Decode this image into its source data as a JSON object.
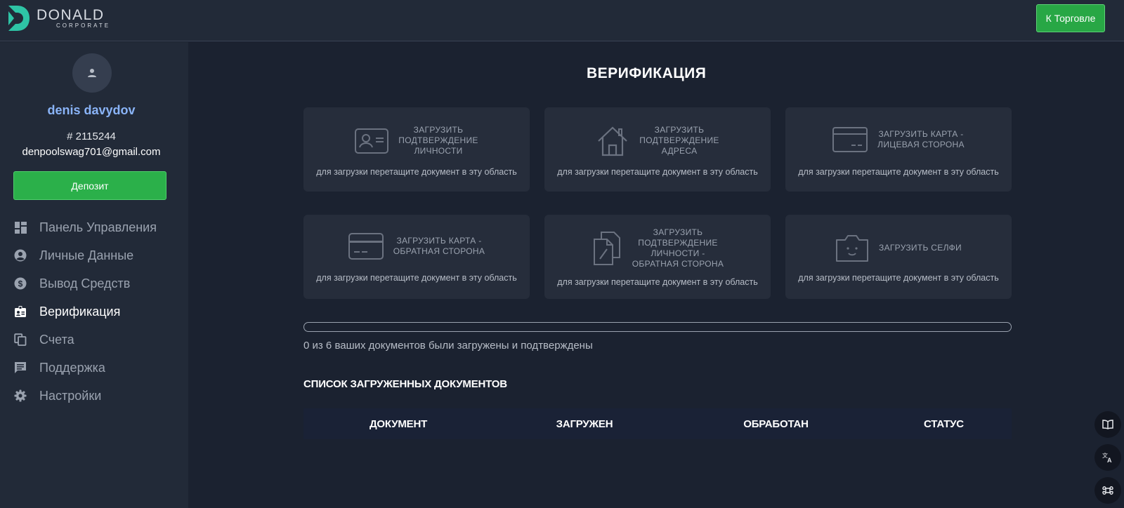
{
  "header": {
    "logo_name": "DONALD",
    "logo_sub": "CORPORATE",
    "trade_button": "К Торговле"
  },
  "sidebar": {
    "user_name": "denis davydov",
    "user_id": "# 2115244",
    "user_email": "denpoolswag701@gmail.com",
    "deposit_button": "Депозит",
    "items": [
      {
        "label": "Панель Управления",
        "icon": "dashboard-icon",
        "active": false
      },
      {
        "label": "Личные Данные",
        "icon": "account-circle-icon",
        "active": false
      },
      {
        "label": "Вывод Средств",
        "icon": "dollar-circle-icon",
        "active": false
      },
      {
        "label": "Верификация",
        "icon": "id-badge-icon",
        "active": true
      },
      {
        "label": "Счета",
        "icon": "copy-icon",
        "active": false
      },
      {
        "label": "Поддержка",
        "icon": "chat-icon",
        "active": false
      },
      {
        "label": "Настройки",
        "icon": "gear-icon",
        "active": false
      }
    ]
  },
  "main": {
    "title": "ВЕРИФИКАЦИЯ",
    "upload_hint": "для загрузки перетащите документ в эту область",
    "cards": [
      {
        "label_lines": [
          "ЗАГРУЗИТЬ",
          "ПОДТВЕРЖДЕНИЕ",
          "ЛИЧНОСТИ"
        ],
        "icon": "id-card-icon"
      },
      {
        "label_lines": [
          "ЗАГРУЗИТЬ",
          "ПОДТВЕРЖДЕНИЕ",
          "АДРЕСА"
        ],
        "icon": "house-icon"
      },
      {
        "label_lines": [
          "ЗАГРУЗИТЬ КАРТА -",
          "ЛИЦЕВАЯ СТОРОНА"
        ],
        "icon": "card-front-icon"
      },
      {
        "label_lines": [
          "ЗАГРУЗИТЬ КАРТА -",
          "ОБРАТНАЯ СТОРОНА"
        ],
        "icon": "card-back-icon"
      },
      {
        "label_lines": [
          "ЗАГРУЗИТЬ",
          "ПОДТВЕРЖДЕНИЕ",
          "ЛИЧНОСТИ -",
          "ОБРАТНАЯ СТОРОНА"
        ],
        "icon": "documents-icon"
      },
      {
        "label_lines": [
          "ЗАГРУЗИТЬ СЕЛФИ"
        ],
        "icon": "selfie-camera-icon"
      }
    ],
    "progress_fraction": 0,
    "progress_text": "0 из 6 ваших документов были загружены и подтверждены",
    "list_title": "СПИСОК ЗАГРУЖЕННЫХ ДОКУМЕНТОВ",
    "table_headers": [
      "ДОКУМЕНТ",
      "ЗАГРУЖЕН",
      "ОБРАБОТАН",
      "СТАТУС"
    ]
  },
  "floating": [
    {
      "icon": "book-icon"
    },
    {
      "icon": "translate-icon"
    },
    {
      "icon": "command-icon"
    }
  ],
  "colors": {
    "accent_green": "#2bb04a",
    "user_name": "#8ab4f8",
    "background": "#1b2230",
    "panel": "#222a38"
  }
}
